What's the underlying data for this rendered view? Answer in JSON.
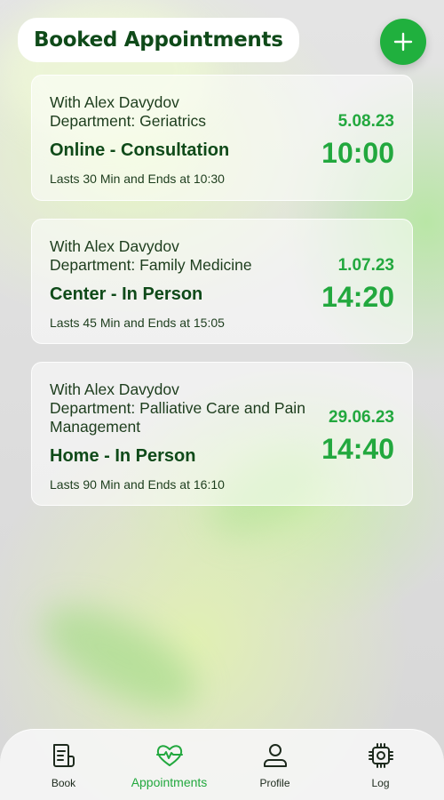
{
  "header": {
    "title": "Booked Appointments"
  },
  "add_button": {
    "icon": "plus-icon"
  },
  "colors": {
    "accent": "#22a83e",
    "title": "#0f4a19",
    "text": "#1d3d1d"
  },
  "appointments": [
    {
      "doctor": "With Alex Davydov",
      "department": "Department: Geriatrics",
      "type": "Online - Consultation",
      "duration": "Lasts 30 Min and Ends at 10:30",
      "date": "5.08.23",
      "time": "10:00"
    },
    {
      "doctor": "With Alex Davydov",
      "department": "Department: Family Medicine",
      "type": "Center - In Person",
      "duration": "Lasts 45 Min and Ends at 15:05",
      "date": "1.07.23",
      "time": "14:20"
    },
    {
      "doctor": "With Alex Davydov",
      "department": "Department: Palliative Care and Pain Management",
      "type": "Home - In Person",
      "duration": "Lasts 90 Min and Ends at 16:10",
      "date": "29.06.23",
      "time": "14:40"
    }
  ],
  "nav": [
    {
      "label": "Book",
      "icon": "document-icon",
      "active": false
    },
    {
      "label": "Appointments",
      "icon": "heart-pulse-icon",
      "active": true
    },
    {
      "label": "Profile",
      "icon": "user-icon",
      "active": false
    },
    {
      "label": "Log",
      "icon": "chip-icon",
      "active": false
    }
  ]
}
